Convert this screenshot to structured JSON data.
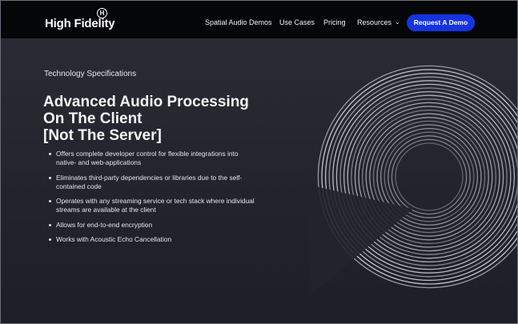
{
  "header": {
    "brand": "High Fidelity",
    "brand_mark": "H",
    "nav": [
      {
        "label": "Spatial Audio Demos"
      },
      {
        "label": "Use Cases"
      },
      {
        "label": "Pricing"
      },
      {
        "label": "Resources"
      }
    ],
    "cta_label": "Request A Demo",
    "cta_color": "#1534e0"
  },
  "hero": {
    "eyebrow": "Technology Specifications",
    "headline_lines": [
      "Advanced Audio Processing",
      "On The Client",
      "[Not The Server]"
    ],
    "bullets": [
      {
        "lines": [
          "Offers complete developer control for flexible integrations into",
          "native- and web-applications"
        ]
      },
      {
        "lines": [
          "Eliminates third-party dependencies or libraries due to the self-",
          "contained code"
        ]
      },
      {
        "lines": [
          "Operates with any streaming service or tech stack where individual",
          "streams are available at the client"
        ]
      },
      {
        "lines": [
          "Allows for end-to-end encryption"
        ]
      },
      {
        "lines": [
          "Works with Acoustic Echo Cancellation"
        ]
      }
    ]
  },
  "icons": {
    "resources_chevron": "chevron-down-icon",
    "decoration": "concentric-rings-graphic"
  }
}
